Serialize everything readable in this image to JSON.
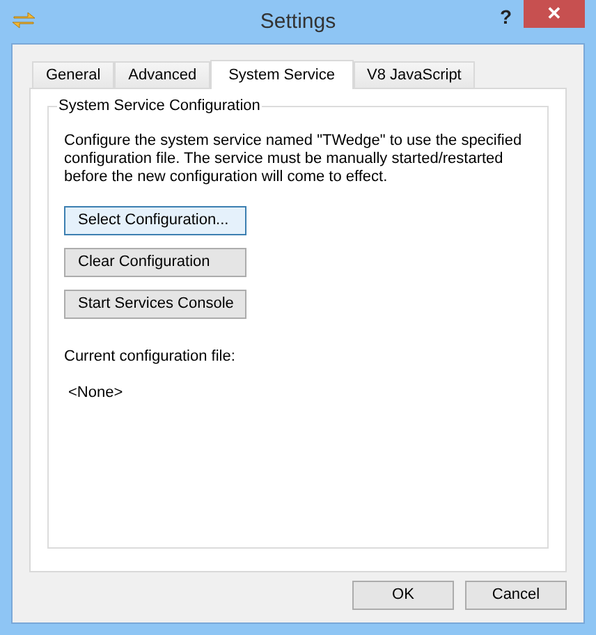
{
  "window": {
    "title": "Settings",
    "help": "?",
    "close": "✕"
  },
  "tabs": [
    {
      "label": "General",
      "selected": false
    },
    {
      "label": "Advanced",
      "selected": false
    },
    {
      "label": "System Service",
      "selected": true
    },
    {
      "label": "V8 JavaScript",
      "selected": false
    }
  ],
  "group": {
    "title": "System Service Configuration",
    "description": "Configure the system service named \"TWedge\" to use the specified configuration file. The service must be manually started/restarted before the new configuration will come to effect.",
    "buttons": [
      {
        "label": "Select Configuration...",
        "focused": true
      },
      {
        "label": "Clear Configuration",
        "focused": false
      },
      {
        "label": "Start Services Console",
        "focused": false
      }
    ],
    "current_label": "Current configuration file:",
    "current_value": "<None>"
  },
  "footer_buttons": [
    "OK",
    "Cancel"
  ]
}
